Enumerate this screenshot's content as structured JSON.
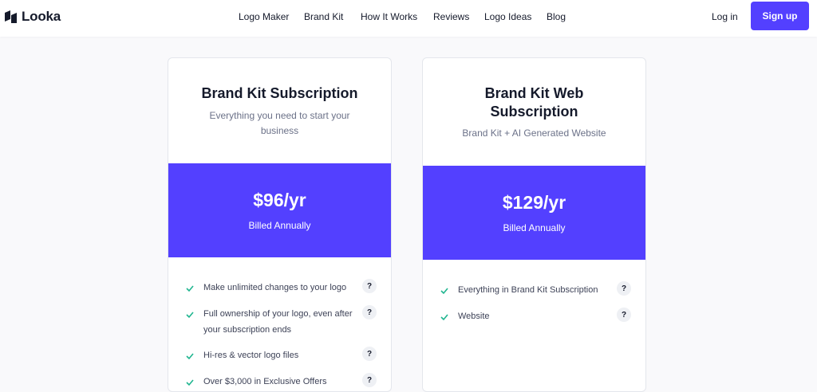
{
  "brand": {
    "name": "Looka",
    "color": "#151a2b"
  },
  "nav": {
    "items": [
      "Logo Maker",
      "Brand Kit",
      "How It Works",
      "Reviews",
      "Logo Ideas",
      "Blog"
    ],
    "login": "Log in",
    "signup": "Sign up"
  },
  "plans": [
    {
      "title_lines": [
        "Brand Kit Subscription"
      ],
      "subtitle_lines": [
        "Everything you need to start your",
        "business"
      ],
      "price": "$96/yr",
      "billing": "Billed Annually",
      "features": [
        {
          "lines": [
            "Make unlimited changes to your logo"
          ],
          "help": "?"
        },
        {
          "lines": [
            "Full ownership of your logo, even after",
            "your subscription ends"
          ],
          "help": "?"
        },
        {
          "lines": [
            "Hi-res & vector logo files"
          ],
          "help": "?"
        },
        {
          "lines": [
            "Over $3,000 in Exclusive Offers"
          ],
          "help": "?"
        }
      ]
    },
    {
      "title_lines": [
        "Brand Kit Web",
        "Subscription"
      ],
      "subtitle_lines": [
        "Brand Kit + AI Generated Website"
      ],
      "price": "$129/yr",
      "billing": "Billed Annually",
      "features": [
        {
          "lines": [
            "Everything in Brand Kit Subscription"
          ],
          "help": "?"
        },
        {
          "lines": [
            "Website"
          ],
          "help": "?"
        }
      ]
    }
  ],
  "colors": {
    "accent": "#5340ff",
    "check": "#1fb58f",
    "background": "#f9f9fb"
  },
  "icons": {
    "check": "check-icon",
    "help": "question-mark-icon",
    "logo": "looka-logo-icon"
  }
}
